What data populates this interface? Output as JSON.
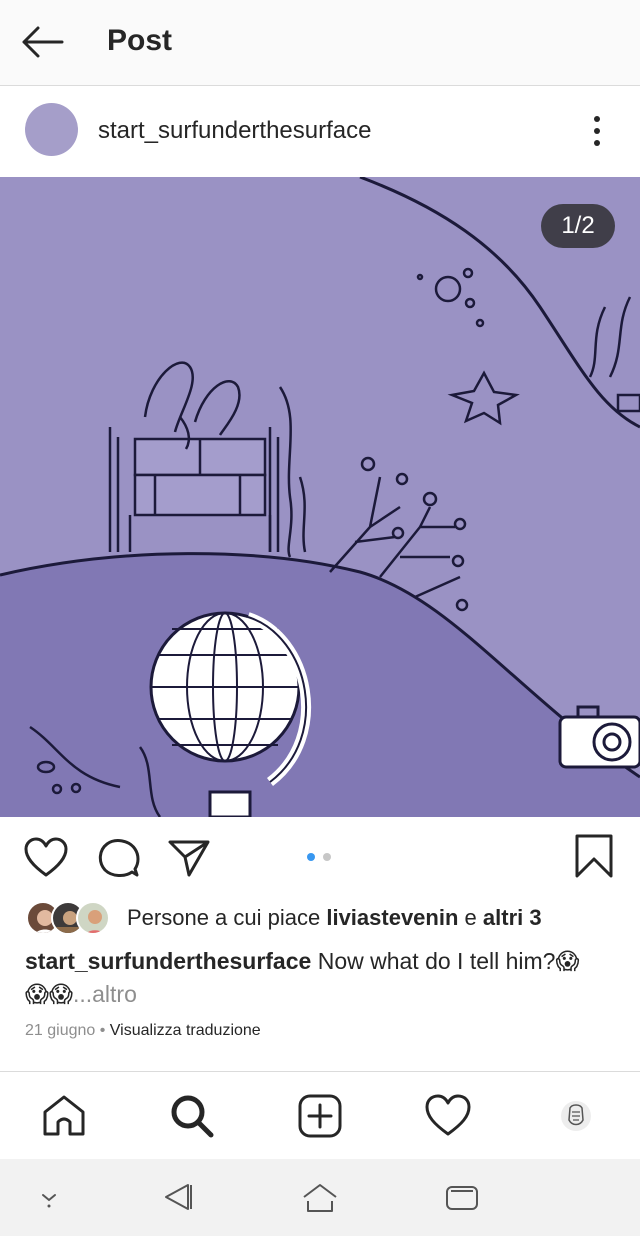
{
  "topbar": {
    "title": "Post",
    "back_icon": "arrow-left-icon"
  },
  "post": {
    "username": "start_surfunderthesurface",
    "counter": "1/2",
    "total_images": 2,
    "current_image": 1,
    "image_description_colors": {
      "background": "#9a92c4",
      "hill": "#8178b4",
      "line": "#1c1a3a"
    }
  },
  "actions": {
    "icons": [
      "heart-icon",
      "comment-icon",
      "share-icon",
      "bookmark-icon"
    ]
  },
  "likes": {
    "prefix": "Persone a cui piace ",
    "user": "liviastevenin",
    "connector": " e ",
    "others": "altri 3"
  },
  "caption": {
    "username": "start_surfunderthesurface",
    "text": " Now what do I tell him?😱",
    "line2": "😱😱",
    "more": "...altro"
  },
  "meta": {
    "date": "21 giugno",
    "separator": " • ",
    "translate": "Visualizza traduzione"
  },
  "bottom_nav": [
    "home-icon",
    "search-icon",
    "new-post-icon",
    "activity-icon",
    "profile-icon"
  ],
  "system_nav": [
    "hide-keyboard-icon",
    "system-back-icon",
    "system-home-icon",
    "recents-icon"
  ],
  "colors": {
    "accent": "#3897f0",
    "muted": "#8e8e8e",
    "text": "#262626"
  }
}
